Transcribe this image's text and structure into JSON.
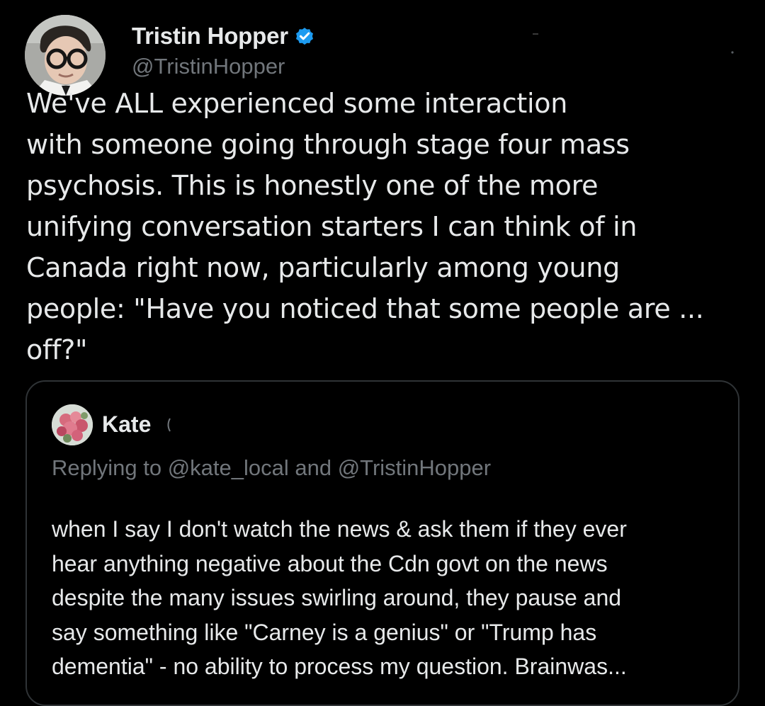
{
  "author": {
    "name": "Tristin Hopper",
    "handle": "@TristinHopper",
    "verified_color": "#1d9bf0"
  },
  "tweet": {
    "text": "We've ALL experienced some interaction\nwith someone going through stage four mass\npsychosis. This is honestly one of the more\nunifying conversation starters I can think of in\nCanada right now, particularly among young\npeople: \"Have you noticed that some people are ...\noff?\""
  },
  "quote": {
    "name": "Kate",
    "replying_to": "Replying to @kate_local and @TristinHopper",
    "text": "when I say I don't watch the news & ask them if they ever\nhear anything negative about the Cdn govt on the news\ndespite the many issues swirling around, they pause and\nsay something like \"Carney is a genius\" or \"Trump has\ndementia\" - no ability to process my question. Brainwas..."
  },
  "colors": {
    "background": "#000000",
    "text_primary": "#e7e9ea",
    "text_secondary": "#71767b",
    "border": "#2f3336",
    "accent": "#1d9bf0"
  },
  "icons": {
    "verified": "verified-badge-icon",
    "more": "more-options-icon"
  }
}
